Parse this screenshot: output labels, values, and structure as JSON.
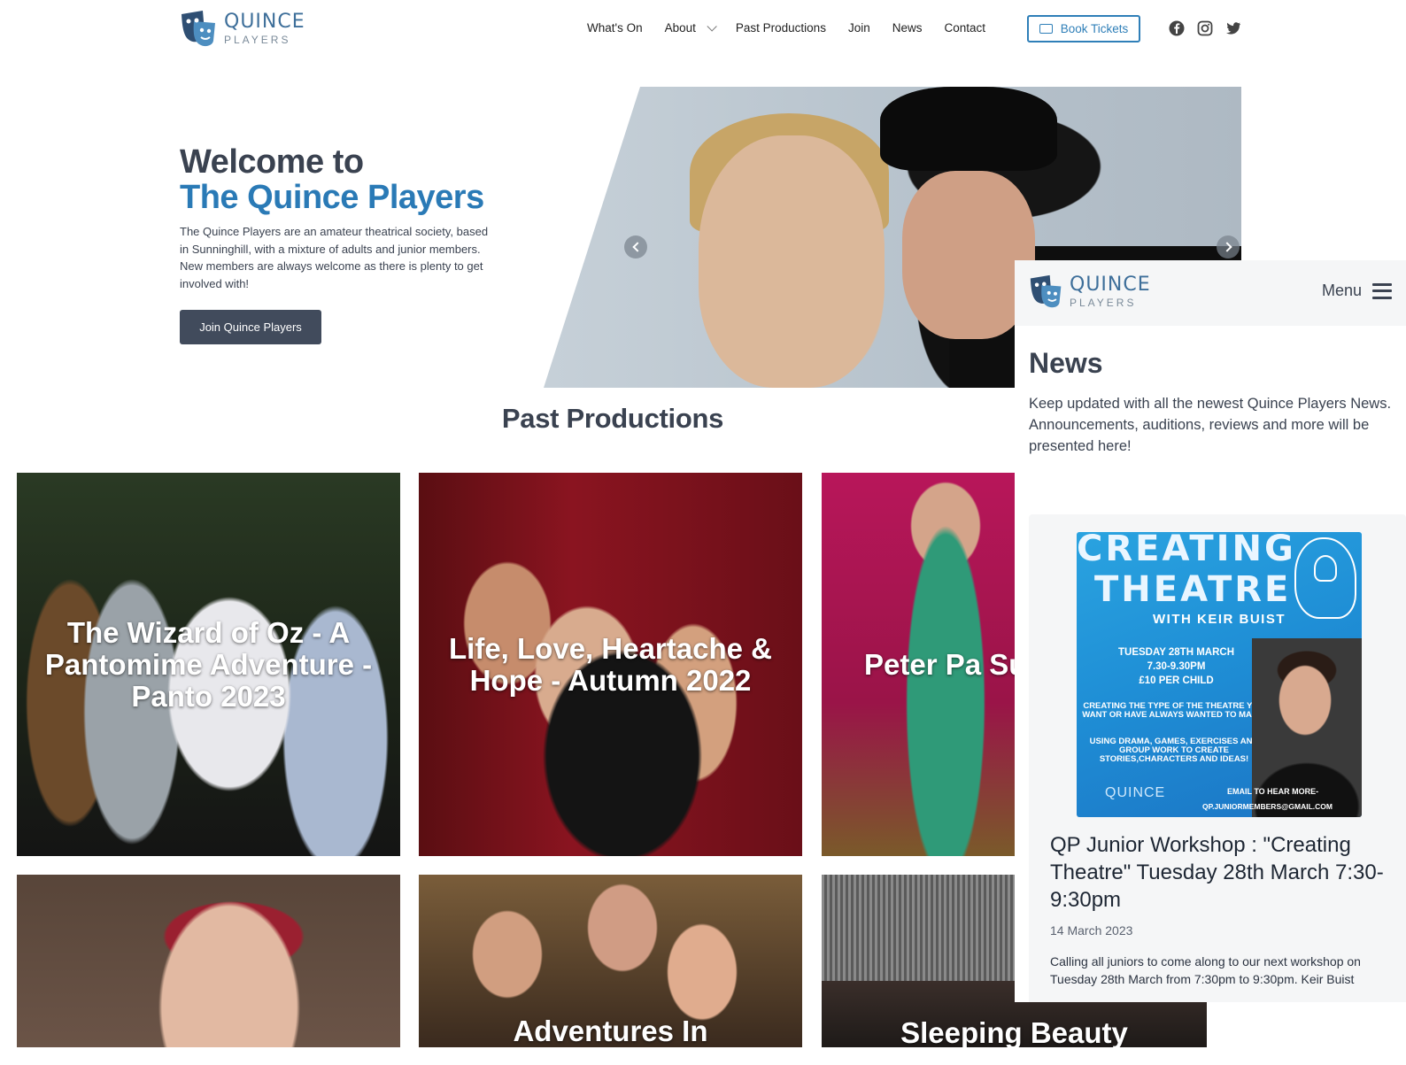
{
  "header": {
    "logo": {
      "word1": "QUINCE",
      "word2": "PLAYERS"
    },
    "nav": [
      "What's On",
      "About",
      "Past Productions",
      "Join",
      "News",
      "Contact"
    ],
    "book_tickets": "Book Tickets",
    "social_icons": [
      "facebook-icon",
      "instagram-icon",
      "twitter-icon"
    ]
  },
  "hero": {
    "title_line1": "Welcome to",
    "title_line2": "The Quince Players",
    "text": "The Quince Players are an amateur theatrical society, based in Sunninghill, with a mixture of adults and junior members. New members are always welcome as there is plenty to get involved with!",
    "button": "Join Quince Players"
  },
  "past_productions": {
    "title": "Past Productions",
    "cards": [
      "The Wizard of Oz - A Pantomime Adventure - Panto 2023",
      "Life, Love, Heartache & Hope - Autumn 2022",
      "Peter Pa Summer Sc",
      "",
      "Adventures In",
      "Sleeping Beauty"
    ]
  },
  "mobile": {
    "logo": {
      "word1": "QUINCE",
      "word2": "PLAYERS"
    },
    "menu_label": "Menu",
    "title": "News",
    "intro": "Keep updated with all the newest Quince Players News. Announcements, auditions, reviews and more will be presented here!",
    "article": {
      "poster": {
        "line1": "CREATING",
        "line2": "THEATRE",
        "line3": "WITH KEIR BUIST",
        "date_lines": "TUESDAY 28TH MARCH\n7.30-9.30PM\n£10 PER CHILD",
        "blurb1": "CREATING THE TYPE OF THE THEATRE YOU WANT OR HAVE ALWAYS WANTED TO MAKE.",
        "blurb2": "USING DRAMA, GAMES, EXERCISES AND GROUP WORK TO CREATE STORIES,CHARACTERS AND IDEAS!",
        "logo": "QUINCE",
        "email_label": "EMAIL TO HEAR MORE-",
        "email": "QP.JUNIORMEMBERS@GMAIL.COM"
      },
      "title": "QP Junior Workshop : \"Creating Theatre\" Tuesday 28th March 7:30-9:30pm",
      "date": "14 March 2023",
      "excerpt": "Calling all juniors to come along to our next workshop on Tuesday 28th March from 7:30pm to 9:30pm. Keir Buist"
    }
  },
  "colors": {
    "brand_blue": "#2a7ab6",
    "dark_slate": "#3a4250",
    "button_dark": "#414b5c"
  }
}
